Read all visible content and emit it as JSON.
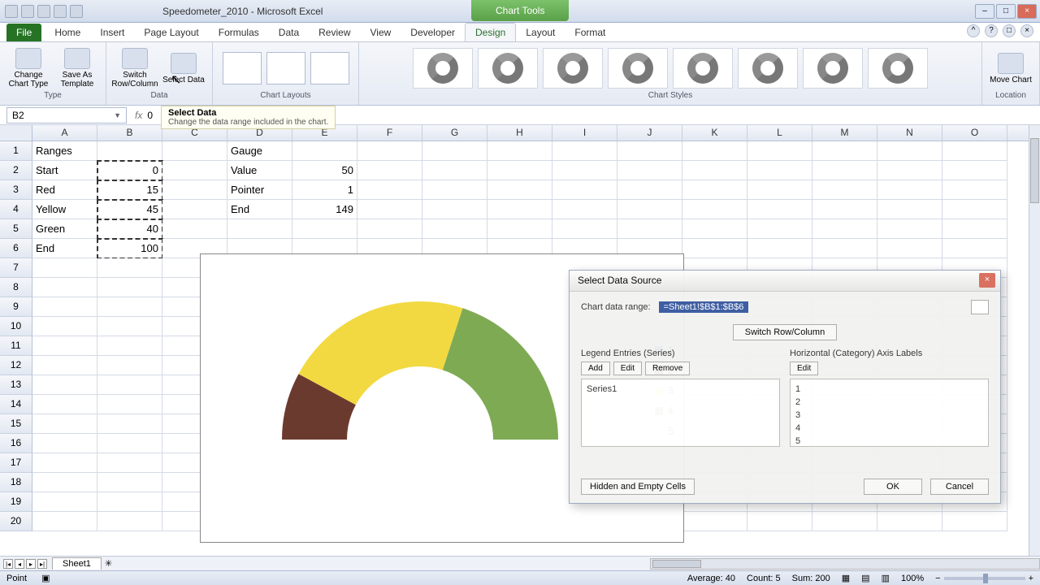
{
  "window": {
    "doc_title": "Speedometer_2010 - Microsoft Excel",
    "chart_tools": "Chart Tools"
  },
  "tabs": {
    "file": "File",
    "home": "Home",
    "insert": "Insert",
    "page_layout": "Page Layout",
    "formulas": "Formulas",
    "data": "Data",
    "review": "Review",
    "view": "View",
    "developer": "Developer",
    "design": "Design",
    "layout": "Layout",
    "format": "Format"
  },
  "ribbon": {
    "type": {
      "change": "Change Chart Type",
      "save": "Save As Template",
      "label": "Type"
    },
    "data": {
      "switch": "Switch Row/Column",
      "select": "Select Data",
      "label": "Data"
    },
    "layouts_label": "Chart Layouts",
    "styles_label": "Chart Styles",
    "location": {
      "move": "Move Chart",
      "label": "Location"
    }
  },
  "tooltip": {
    "title": "Select Data",
    "body": "Change the data range included in the chart."
  },
  "namebox": "B2",
  "fx_value": "0",
  "columns": [
    "A",
    "B",
    "C",
    "D",
    "E",
    "F",
    "G",
    "H",
    "I",
    "J",
    "K",
    "L",
    "M",
    "N",
    "O"
  ],
  "cells": {
    "A1": "Ranges",
    "D1": "Gauge",
    "A2": "Start",
    "B2": "0",
    "D2": "Value",
    "E2": "50",
    "A3": "Red",
    "B3": "15",
    "D3": "Pointer",
    "E3": "1",
    "A4": "Yellow",
    "B4": "45",
    "D4": "End",
    "E4": "149",
    "A5": "Green",
    "B5": "40",
    "A6": "End",
    "B6": "100"
  },
  "chart_data": {
    "type": "pie",
    "title": "",
    "series": [
      {
        "name": "Series1",
        "values": [
          0,
          15,
          45,
          40,
          100
        ]
      }
    ],
    "categories": [
      "1",
      "2",
      "3",
      "4",
      "5"
    ],
    "colors": {
      "1": "#4e6ea8",
      "2": "#6b3a2f",
      "3": "#f2d941",
      "4": "#7faa54",
      "5": "#ffffff"
    },
    "legend": [
      "1",
      "2",
      "3",
      "4",
      "5"
    ]
  },
  "dialog": {
    "title": "Select Data Source",
    "range_label": "Chart data range:",
    "range_value": "=Sheet1!$B$1:$B$6",
    "switch": "Switch Row/Column",
    "legend_title": "Legend Entries (Series)",
    "axis_title": "Horizontal (Category) Axis Labels",
    "add": "Add",
    "edit": "Edit",
    "remove": "Remove",
    "edit2": "Edit",
    "series": [
      "Series1"
    ],
    "cats": [
      "1",
      "2",
      "3",
      "4",
      "5"
    ],
    "hidden": "Hidden and Empty Cells",
    "ok": "OK",
    "cancel": "Cancel"
  },
  "sheet": {
    "name": "Sheet1"
  },
  "status": {
    "mode": "Point",
    "avg_label": "Average:",
    "avg": "40",
    "count_label": "Count:",
    "count": "5",
    "sum_label": "Sum:",
    "sum": "200",
    "zoom": "100%"
  }
}
